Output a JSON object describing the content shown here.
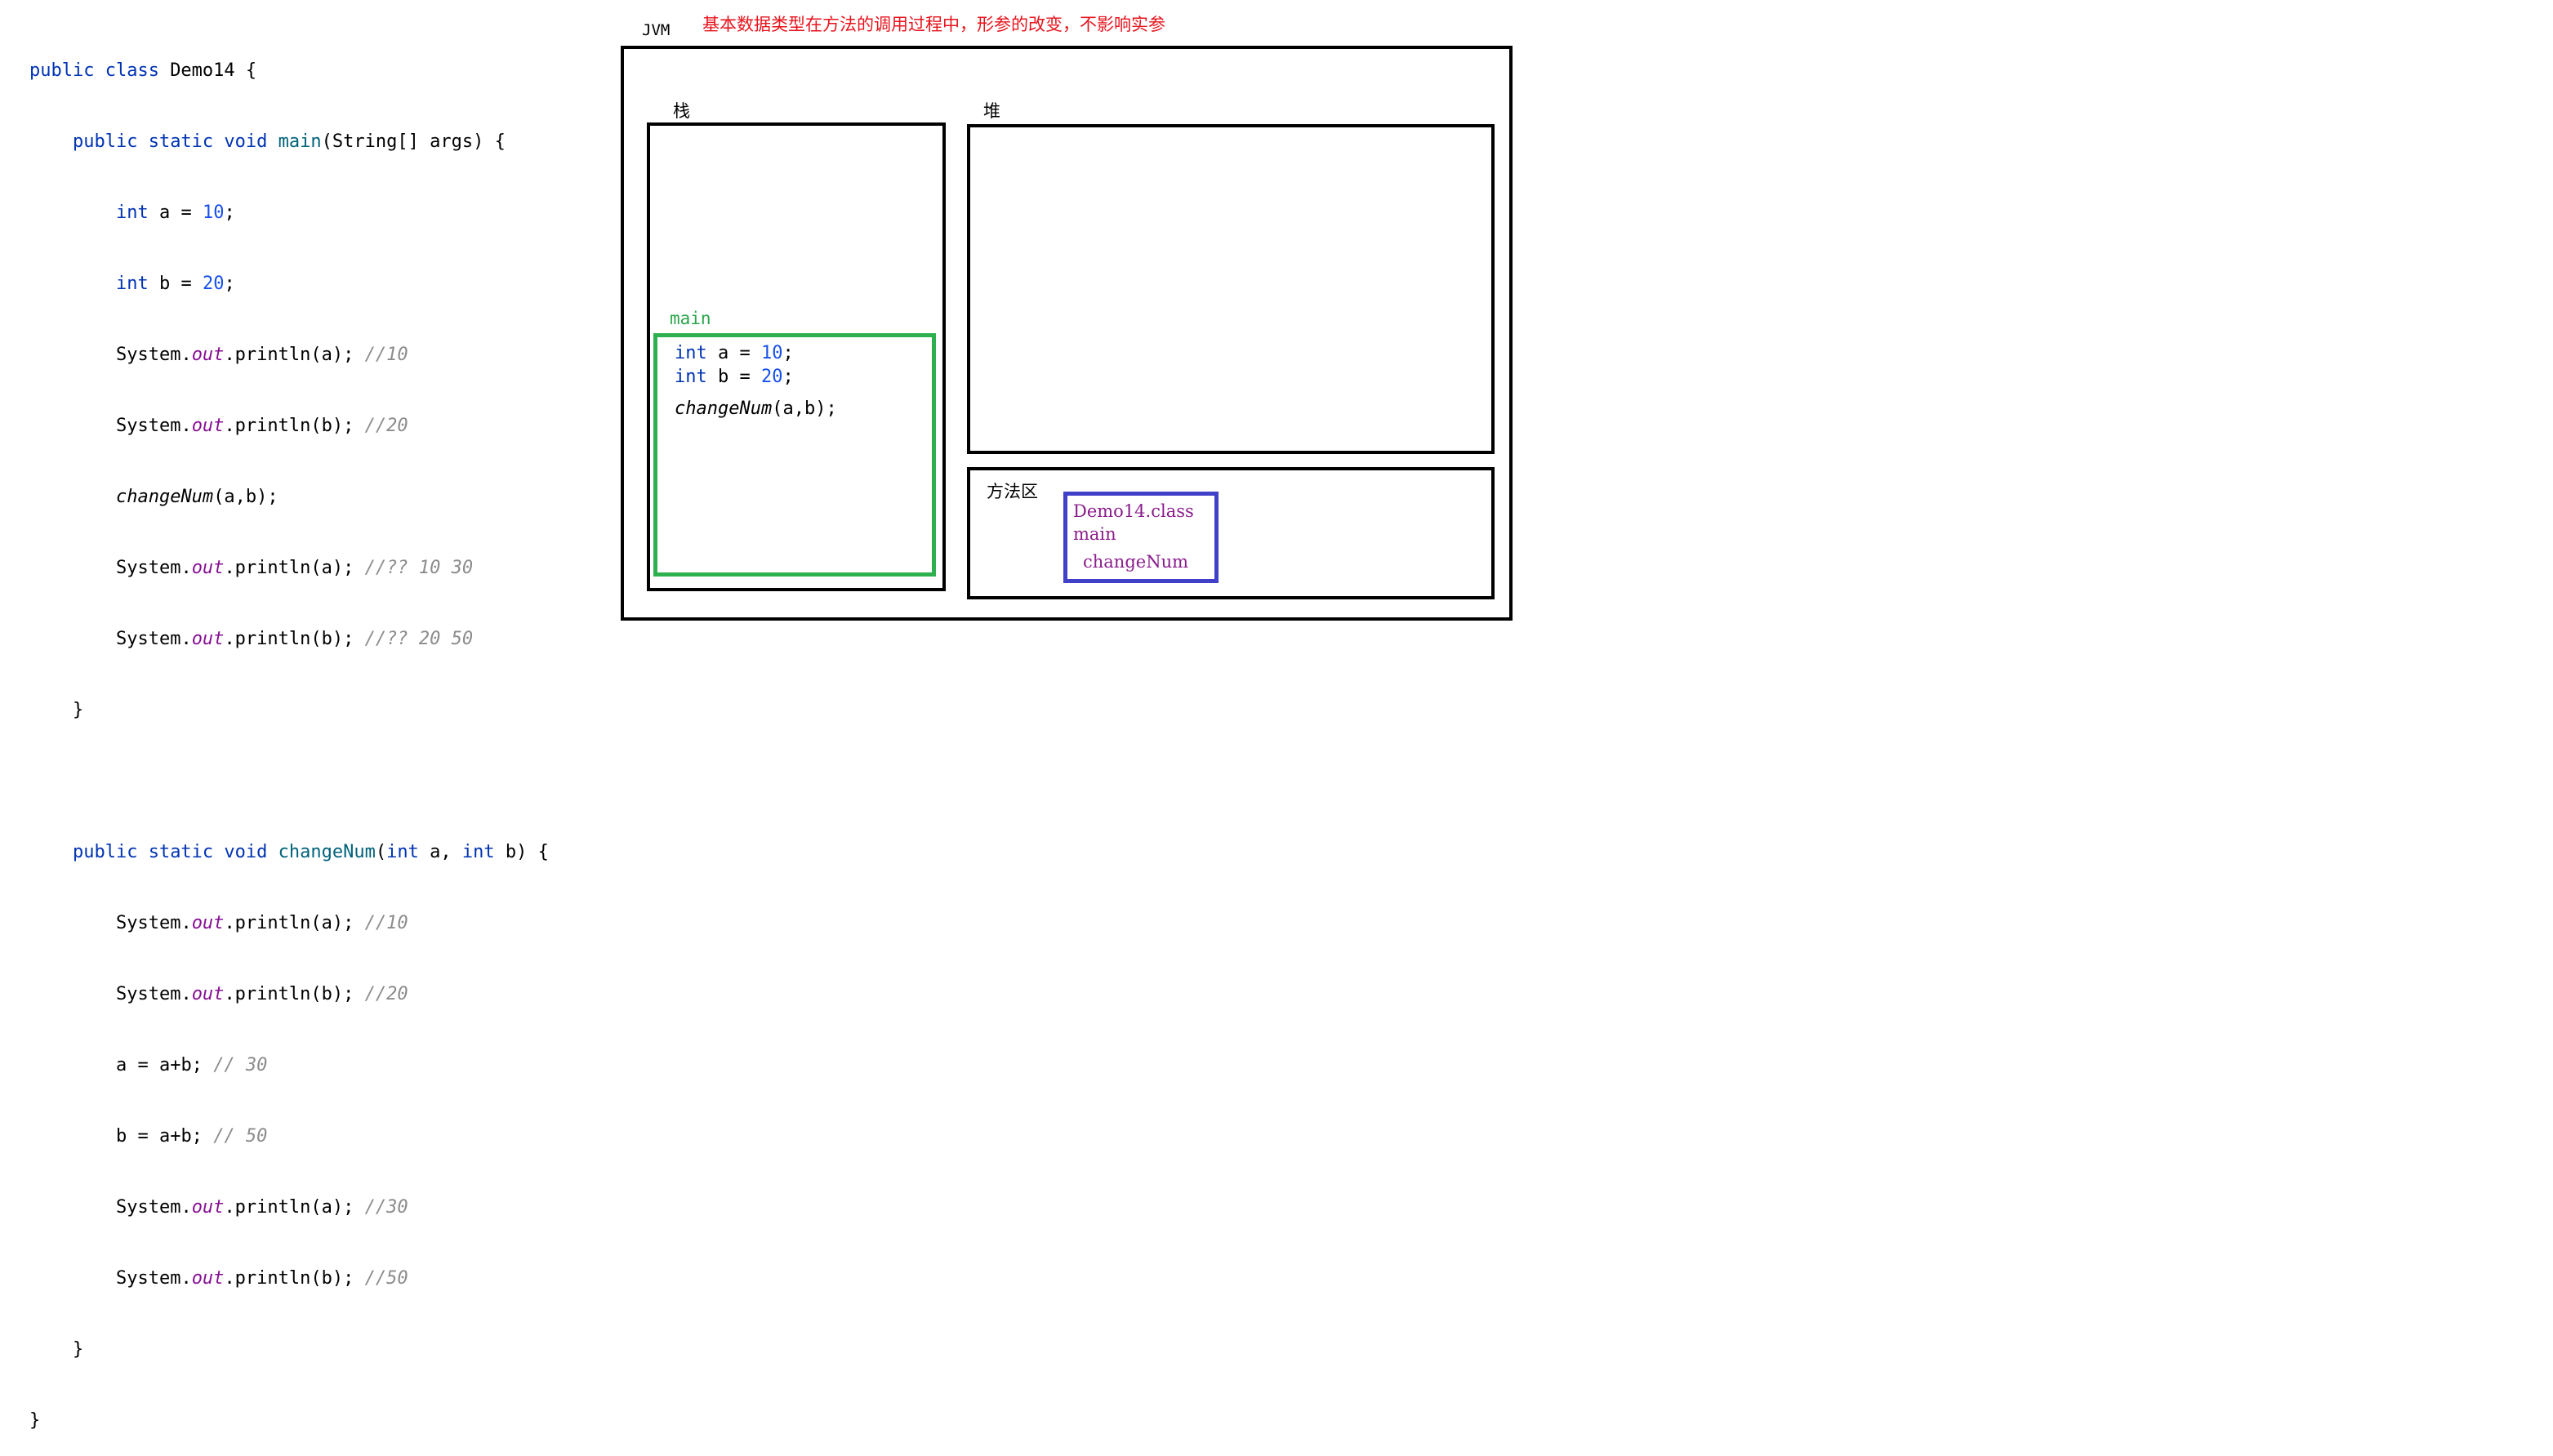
{
  "code": {
    "line1": {
      "kw": "public class ",
      "name": "Demo14 {"
    },
    "line2": {
      "kw": "public static void ",
      "fn": "main",
      "rest": "(String[] args) {"
    },
    "line3": {
      "kw": "int",
      "mid": " a = ",
      "num": "10",
      "end": ";"
    },
    "line4": {
      "kw": "int",
      "mid": " b = ",
      "num": "20",
      "end": ";"
    },
    "line5": {
      "pre": "System.",
      "st": "out",
      "mid": ".println(a); ",
      "cm": "//10"
    },
    "line6": {
      "pre": "System.",
      "st": "out",
      "mid": ".println(b); ",
      "cm": "//20"
    },
    "line7": {
      "it": "changeNum",
      "rest": "(a,b);"
    },
    "line8": {
      "pre": "System.",
      "st": "out",
      "mid": ".println(a); ",
      "cm": "//?? 10 30"
    },
    "line9": {
      "pre": "System.",
      "st": "out",
      "mid": ".println(b); ",
      "cm": "//?? 20 50"
    },
    "line10": "}",
    "line12": {
      "kw": "public static void ",
      "fn": "changeNum",
      "p1": "(",
      "kw2": "int",
      "p2": " a, ",
      "kw3": "int",
      "p3": " b) {"
    },
    "line13": {
      "pre": "System.",
      "st": "out",
      "mid": ".println(a); ",
      "cm": "//10"
    },
    "line14": {
      "pre": "System.",
      "st": "out",
      "mid": ".println(b); ",
      "cm": "//20"
    },
    "line15": {
      "pre": "a = a+b; ",
      "cm": "// 30"
    },
    "line16": {
      "pre": "b = a+b; ",
      "cm": "// 50"
    },
    "line17": {
      "pre": "System.",
      "st": "out",
      "mid": ".println(a); ",
      "cm": "//30"
    },
    "line18": {
      "pre": "System.",
      "st": "out",
      "mid": ".println(b); ",
      "cm": "//50"
    },
    "line19": "}",
    "line20": "}"
  },
  "diagram": {
    "jvm_label": "JVM",
    "note": "基本数据类型在方法的调用过程中，形参的改变，不影响实参",
    "stack_label": "栈",
    "heap_label": "堆",
    "method_area_label": "方法区",
    "frame": {
      "label": "main",
      "line1": {
        "kw": "int",
        "mid": " a = ",
        "num": "10",
        "end": ";"
      },
      "line2": {
        "kw": "int",
        "mid": " b = ",
        "num": "20",
        "end": ";"
      },
      "line3": {
        "it": "changeNum",
        "rest": "(a,b);"
      }
    },
    "class_area": {
      "class_name": "Demo14.class",
      "method1": "main",
      "method2": "changeNum"
    }
  },
  "colors": {
    "keyword": "#0033b3",
    "number": "#1750eb",
    "method_name": "#00627a",
    "static_field": "#871094",
    "comment": "#8c8c8c",
    "note": "#e8131c",
    "frame_border": "#2fb04f",
    "class_border": "#4040c8",
    "class_text": "#8a1c8c"
  }
}
